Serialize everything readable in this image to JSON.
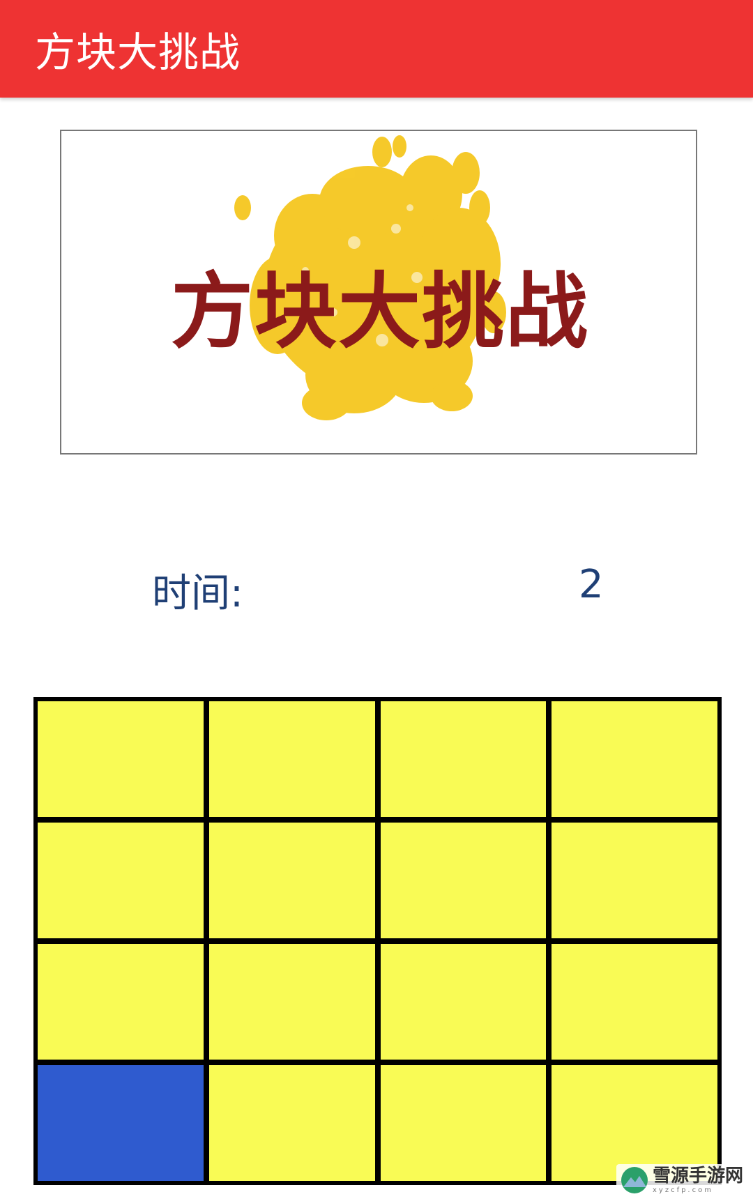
{
  "app_bar": {
    "title": "方块大挑战",
    "color": "#ee3333"
  },
  "banner": {
    "title": "方块大挑战",
    "title_color": "#8b1a1a",
    "splash_color": "#f5c518"
  },
  "timer": {
    "label": "时间:",
    "value": "2"
  },
  "grid": {
    "rows": 4,
    "cols": 4,
    "tile_color": "#f9fb55",
    "active_color": "#2f5bcf",
    "cells": [
      [
        "yellow",
        "yellow",
        "yellow",
        "yellow"
      ],
      [
        "yellow",
        "yellow",
        "yellow",
        "yellow"
      ],
      [
        "yellow",
        "yellow",
        "yellow",
        "yellow"
      ],
      [
        "blue",
        "yellow",
        "yellow",
        "yellow"
      ]
    ]
  },
  "watermark": {
    "cn": "雪源手游网",
    "en": "xyzcfp.com"
  }
}
